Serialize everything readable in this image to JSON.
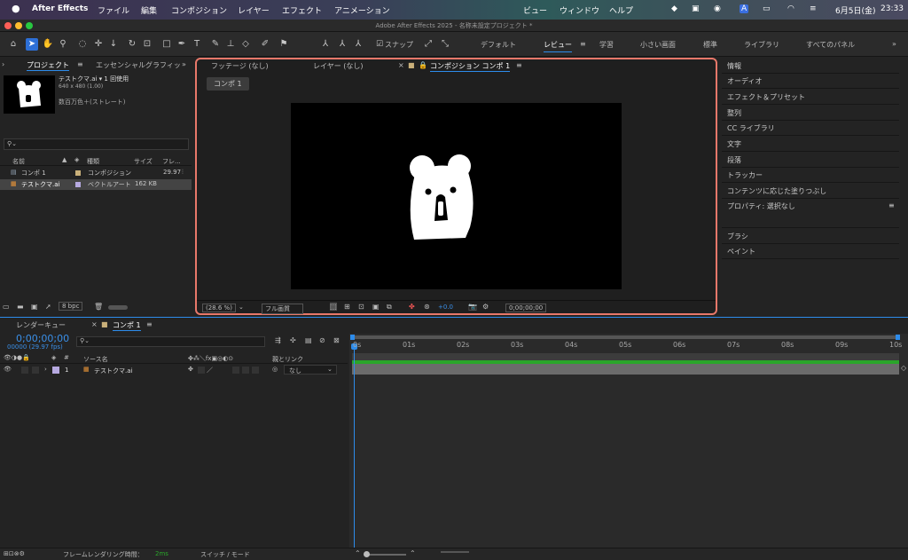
{
  "menubar": {
    "app_name": "After Effects",
    "items": [
      "ファイル",
      "編集",
      "コンポジション",
      "レイヤー",
      "エフェクト",
      "アニメーション",
      "ビュー",
      "ウィンドウ",
      "ヘルプ"
    ],
    "input_mode": "A",
    "date": "6月5日(金)",
    "time": "23:33"
  },
  "window": {
    "title": "Adobe After Effects 2025 - 名称未設定プロジェクト *"
  },
  "toolbar": {
    "snap_label": "スナップ",
    "workspaces": [
      "デフォルト",
      "レビュー",
      "学習",
      "小さい画面",
      "標準",
      "ライブラリ",
      "すべてのパネル"
    ],
    "active_workspace": "レビュー"
  },
  "project": {
    "tab": "プロジェクト",
    "tab2": "エッセンシャルグラフィッ",
    "item_name": "テストクマ.ai ▾ 1 回使用",
    "item_dims": "640 x 480 (1.00)",
    "item_color": "数百万色＋(ストレート)",
    "search_placeholder": "",
    "columns": [
      "名前",
      "種類",
      "サイズ",
      "フレ..."
    ],
    "rows": [
      {
        "name": "コンポ 1",
        "type": "コンポジション",
        "size": "",
        "fps": "29.97"
      },
      {
        "name": "テストクマ.ai",
        "type": "ベクトルアート",
        "size": "162 KB",
        "fps": ""
      }
    ],
    "bpc": "8 bpc"
  },
  "viewer": {
    "tabs": [
      "フッテージ (なし)",
      "レイヤー (なし)",
      "コンポジション コンポ 1"
    ],
    "breadcrumb": "コンポ 1",
    "zoom": "(28.6 %)",
    "quality": "フル画質",
    "exposure": "+0.0",
    "timecode": "0;00;00;00"
  },
  "right_panel": {
    "items": [
      "情報",
      "オーディオ",
      "エフェクト＆プリセット",
      "整列",
      "CC ライブラリ",
      "文字",
      "段落",
      "トラッカー",
      "コンテンツに応じた塗りつぶし",
      "プロパティ: 選択なし",
      "ブラシ",
      "ペイント"
    ]
  },
  "timeline": {
    "tab_render": "レンダーキュー",
    "tab_comp": "コンポ 1",
    "timecode": "0;00;00;00",
    "fps_line": "00000 (29.97 fps)",
    "col_source": "ソース名",
    "col_parent": "親とリンク",
    "layer_num": "1",
    "layer_name": "テストクマ.ai",
    "parent_value": "なし",
    "ticks": [
      "0s",
      "01s",
      "02s",
      "03s",
      "04s",
      "05s",
      "06s",
      "07s",
      "08s",
      "09s",
      "10s"
    ],
    "status_label": "フレームレンダリング時間：",
    "status_value": "2ms",
    "switch_mode": "スイッチ / モード"
  }
}
